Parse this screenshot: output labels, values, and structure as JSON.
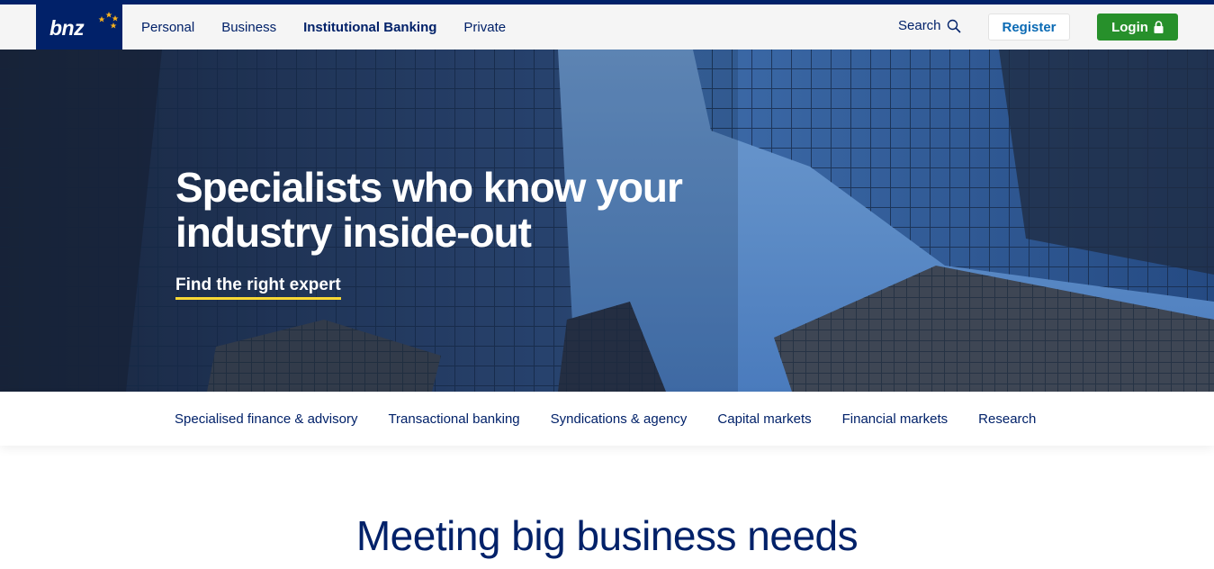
{
  "brand": {
    "logo_text": "bnz",
    "color": "#012169",
    "star_color": "#f9b21d"
  },
  "header": {
    "nav": [
      {
        "label": "Personal",
        "active": false
      },
      {
        "label": "Business",
        "active": false
      },
      {
        "label": "Institutional Banking",
        "active": true
      },
      {
        "label": "Private",
        "active": false
      }
    ],
    "search_label": "Search",
    "search_icon": "magnifier-icon",
    "register_label": "Register",
    "login_label": "Login",
    "login_icon": "lock-icon",
    "login_color": "#27902b"
  },
  "hero": {
    "title_line1": "Specialists who know your",
    "title_line2": "industry inside-out",
    "link_label": "Find the right expert",
    "link_underline_color": "#f9d835"
  },
  "subnav": {
    "items": [
      "Specialised finance & advisory",
      "Transactional banking",
      "Syndications & agency",
      "Capital markets",
      "Financial markets",
      "Research"
    ]
  },
  "main": {
    "heading": "Meeting big business needs"
  }
}
